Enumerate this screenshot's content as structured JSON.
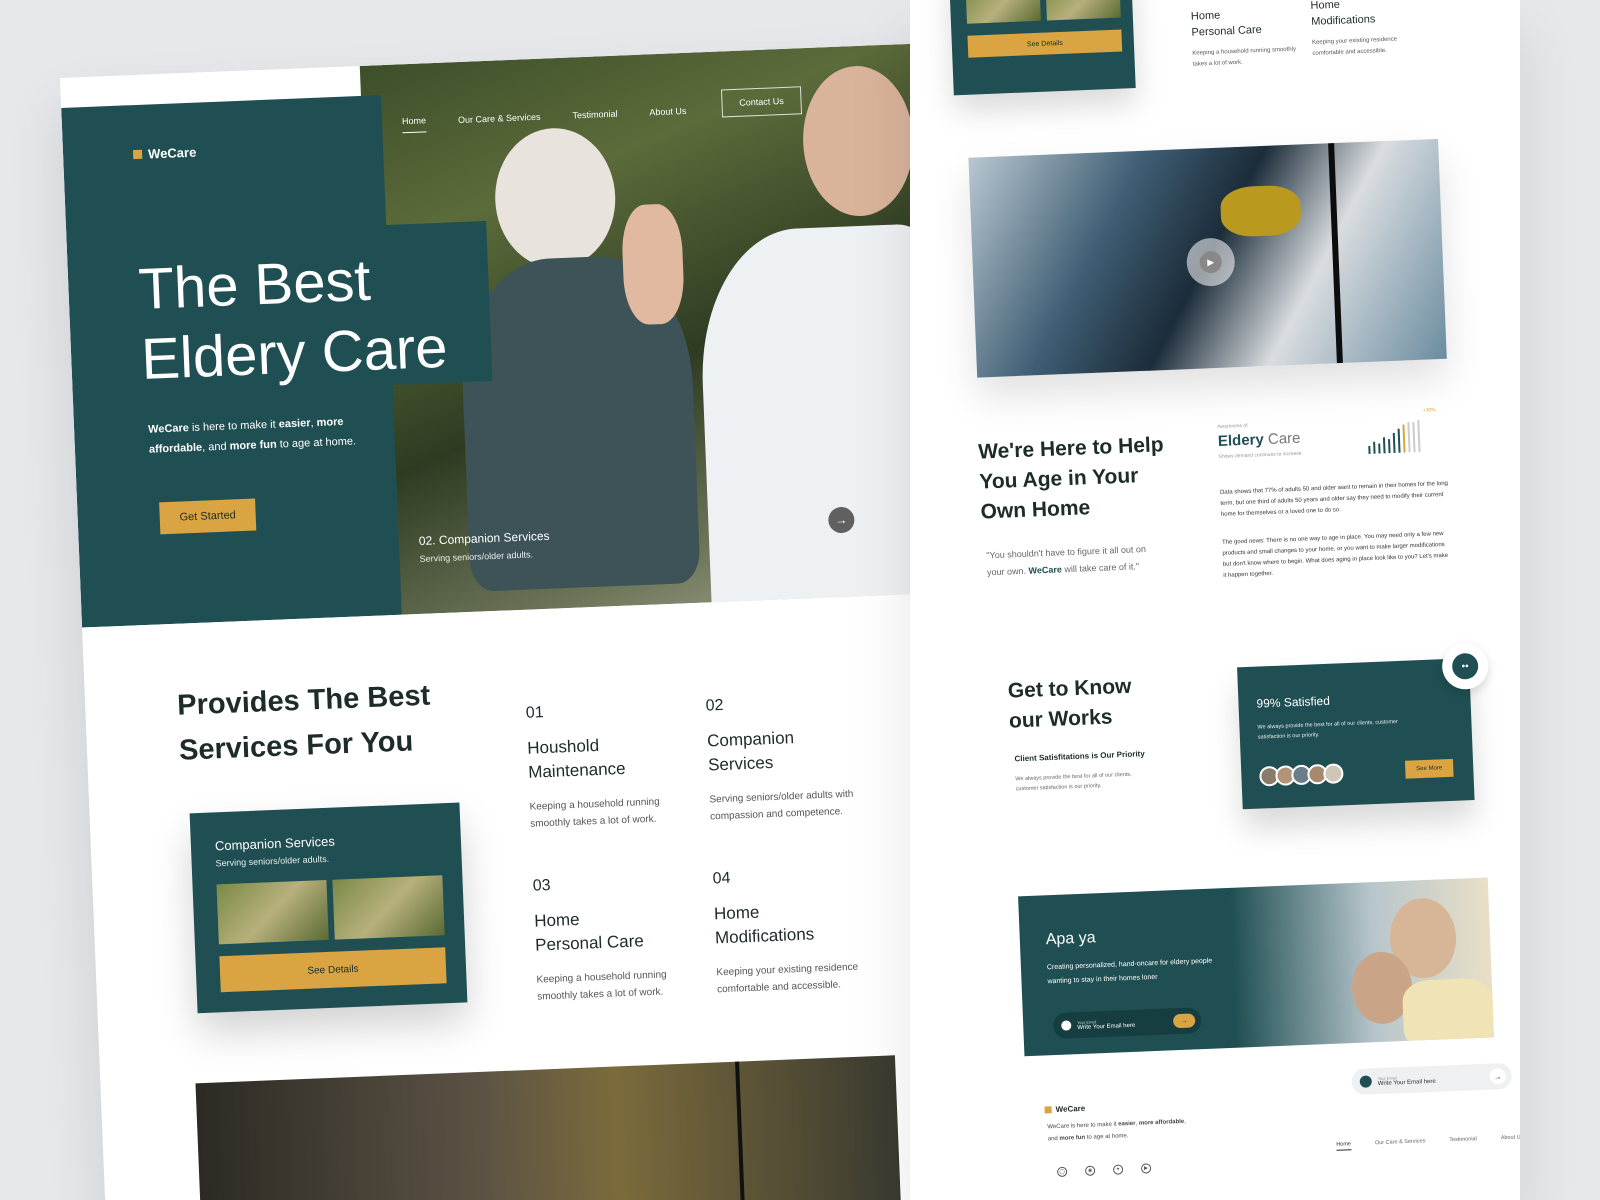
{
  "brand": {
    "name": "WeCare",
    "accent": "#d9a441",
    "primary": "#1f4f52"
  },
  "nav": {
    "items": [
      "Home",
      "Our Care & Services",
      "Testimonial",
      "About Us"
    ],
    "active": "Home",
    "contact_label": "Contact Us"
  },
  "hero": {
    "title_line1": "The Best",
    "title_line2": "Eldery Care",
    "desc_brand": "WeCare",
    "desc_a": " is here to make it ",
    "desc_b": "easier",
    "desc_c": ", ",
    "desc_d": "more affordable",
    "desc_e": ", and ",
    "desc_f": "more fun",
    "desc_g": " to age at home.",
    "cta_label": "Get Started",
    "slide_title": "02. Companion Services",
    "slide_sub": "Serving seniors/older adults.",
    "next_icon": "arrow-right-icon"
  },
  "services": {
    "title_line1": "Provides The Best",
    "title_line2": "Services For You",
    "card": {
      "title": "Companion Services",
      "subtitle": "Serving seniors/older adults.",
      "button": "See Details"
    },
    "items": [
      {
        "num": "01",
        "name_line1": "Houshold",
        "name_line2": "Maintenance",
        "desc": "Keeping a household running smoothly takes a lot of work."
      },
      {
        "num": "02",
        "name_line1": "Companion",
        "name_line2": "Services",
        "desc": "Serving seniors/older adults with compassion and competence."
      },
      {
        "num": "03",
        "name_line1": "Home",
        "name_line2": "Personal Care",
        "desc": "Keeping a household running smoothly takes a lot of work."
      },
      {
        "num": "04",
        "name_line1": "Home",
        "name_line2": "Modifications",
        "desc": "Keeping your existing residence comfortable and accessible."
      }
    ]
  },
  "help": {
    "title": "We're Here to Help You Age in Your Own Home",
    "quote_a": "\"You shouldn't have to figure it all out on your own. ",
    "quote_brand": "WeCare",
    "quote_b": " will take care of it.\"",
    "awareness_small": "Awareness of",
    "awareness_big_a": "Eldery",
    "awareness_big_b": " Care",
    "awareness_sub": "Shows demand continues to increase",
    "pct": "+30%",
    "p1": "Data shows that 77% of adults 50 and older want to remain in their homes for the long term, but one third of adults 50 years and older say they need to modify their current home for themselves or a loved one to do so.",
    "p2": "The good news: There is no one way to age in place. You may need only a few new products and small changes to your home, or you want to make larger modifications but don't know where to begin. What does aging in place look like to you? Let's make it happen together."
  },
  "works": {
    "title_line1": "Get to Know",
    "title_line2": "our Works",
    "sub": "Client Satisfitations is Our Priority",
    "desc": "We always provide the best for all of our clients, customer satisfaction is our priority.",
    "card_title": "99% Satisfied",
    "card_desc": "We always provide the best for all of our clients, customer satisfaction is our priority.",
    "card_button": "See More"
  },
  "cta": {
    "title": "Apa ya",
    "desc": "Creating personalized, hand-oncare for eldery people wanting to stay in their homes loner",
    "email_label": "Your Email",
    "email_placeholder": "Write Your Email here"
  },
  "footer": {
    "brand": "WeCare",
    "desc_a": "WeCare is here to make it ",
    "desc_b": "easier",
    "desc_c": ", ",
    "desc_d": "more affordable",
    "desc_e": ", and ",
    "desc_f": "more fun",
    "desc_g": " to age at home.",
    "email_label": "Your Email",
    "email_placeholder": "Write Your Email here",
    "nav": [
      "Home",
      "Our Care & Services",
      "Testimonial",
      "About Us"
    ],
    "socials": [
      "instagram-icon",
      "dribbble-icon",
      "twitter-icon",
      "youtube-icon"
    ]
  }
}
